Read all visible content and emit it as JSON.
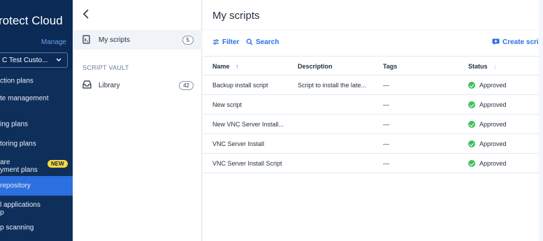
{
  "nav": {
    "brand": "rotect Cloud",
    "manage": "Manage",
    "tenant": "C Test Custo...",
    "items": [
      {
        "label": "ction plans"
      },
      {
        "label": "te management"
      },
      {
        "label": "ing plans"
      },
      {
        "label": "toring plans"
      },
      {
        "label": "are\nyment plans",
        "badge": "NEW"
      },
      {
        "label": " repository"
      },
      {
        "label": "l applications\np"
      },
      {
        "label": "p scanning"
      }
    ]
  },
  "middle": {
    "back_icon": "chevron-left-icon",
    "my_scripts": {
      "label": "My scripts",
      "count": "5"
    },
    "section_title": "SCRIPT VAULT",
    "library": {
      "label": "Library",
      "count": "42"
    }
  },
  "main": {
    "title": "My scripts",
    "filter_label": "Filter",
    "search_label": "Search",
    "create_label": "Create script",
    "columns": {
      "name": "Name",
      "description": "Description",
      "tags": "Tags",
      "status": "Status"
    },
    "rows": [
      {
        "name": "Backup install script",
        "description": "Script to install the late...",
        "tags": "—",
        "status": "Approved"
      },
      {
        "name": "New script",
        "description": "",
        "tags": "—",
        "status": "Approved"
      },
      {
        "name": "New VNC Server Install...",
        "description": "",
        "tags": "—",
        "status": "Approved"
      },
      {
        "name": "VNC Server Install",
        "description": "",
        "tags": "—",
        "status": "Approved"
      },
      {
        "name": "VNC Server Install Script",
        "description": "",
        "tags": "—",
        "status": "Approved"
      }
    ]
  },
  "colors": {
    "nav_bg": "#0b2a56",
    "nav_active": "#2b6fe0",
    "accent": "#2b6fe0",
    "approved": "#3fbf5b",
    "new_badge": "#ffd93b"
  }
}
